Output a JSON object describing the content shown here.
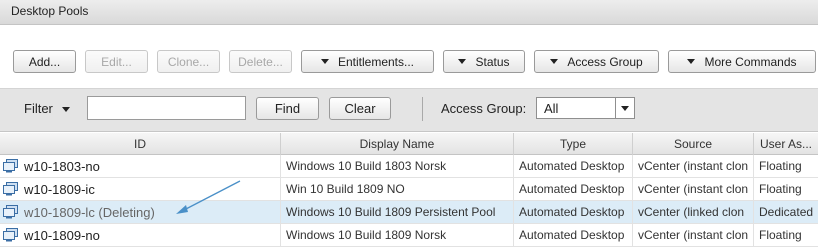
{
  "window": {
    "title": "Desktop Pools"
  },
  "toolbar": {
    "add": "Add...",
    "edit": "Edit...",
    "clone": "Clone...",
    "delete": "Delete...",
    "entitlements": "Entitlements...",
    "status": "Status",
    "access_group": "Access Group",
    "more_commands": "More Commands"
  },
  "filter": {
    "label": "Filter",
    "input_value": "",
    "find": "Find",
    "clear": "Clear",
    "access_group_label": "Access Group:",
    "access_group_value": "All"
  },
  "table": {
    "columns": [
      "ID",
      "Display Name",
      "Type",
      "Source",
      "User As..."
    ],
    "rows": [
      {
        "id": "w10-1803-no",
        "display_name": "Windows 10 Build 1803 Norsk",
        "type": "Automated Desktop",
        "source": "vCenter (instant clon",
        "user_assignment": "Floating",
        "selected": false
      },
      {
        "id": "w10-1809-ic",
        "display_name": "Win 10 Build 1809 NO",
        "type": "Automated Desktop",
        "source": "vCenter (instant clon",
        "user_assignment": "Floating",
        "selected": false
      },
      {
        "id": "w10-1809-lc (Deleting)",
        "display_name": "Windows 10 Build 1809 Persistent Pool",
        "type": "Automated Desktop",
        "source": "vCenter (linked clon",
        "user_assignment": "Dedicated",
        "selected": true
      },
      {
        "id": "w10-1809-no",
        "display_name": "Windows 10 Build 1809 Norsk",
        "type": "Automated Desktop",
        "source": "vCenter (instant clon",
        "user_assignment": "Floating",
        "selected": false
      }
    ]
  },
  "colors": {
    "selected_row": "#dcecf7",
    "annotation_arrow": "#4a90c8",
    "icon_blue": "#3b6ea5"
  },
  "icons": {
    "pool": "desktop-pool-icon",
    "dropdown": "chevron-down-icon"
  }
}
